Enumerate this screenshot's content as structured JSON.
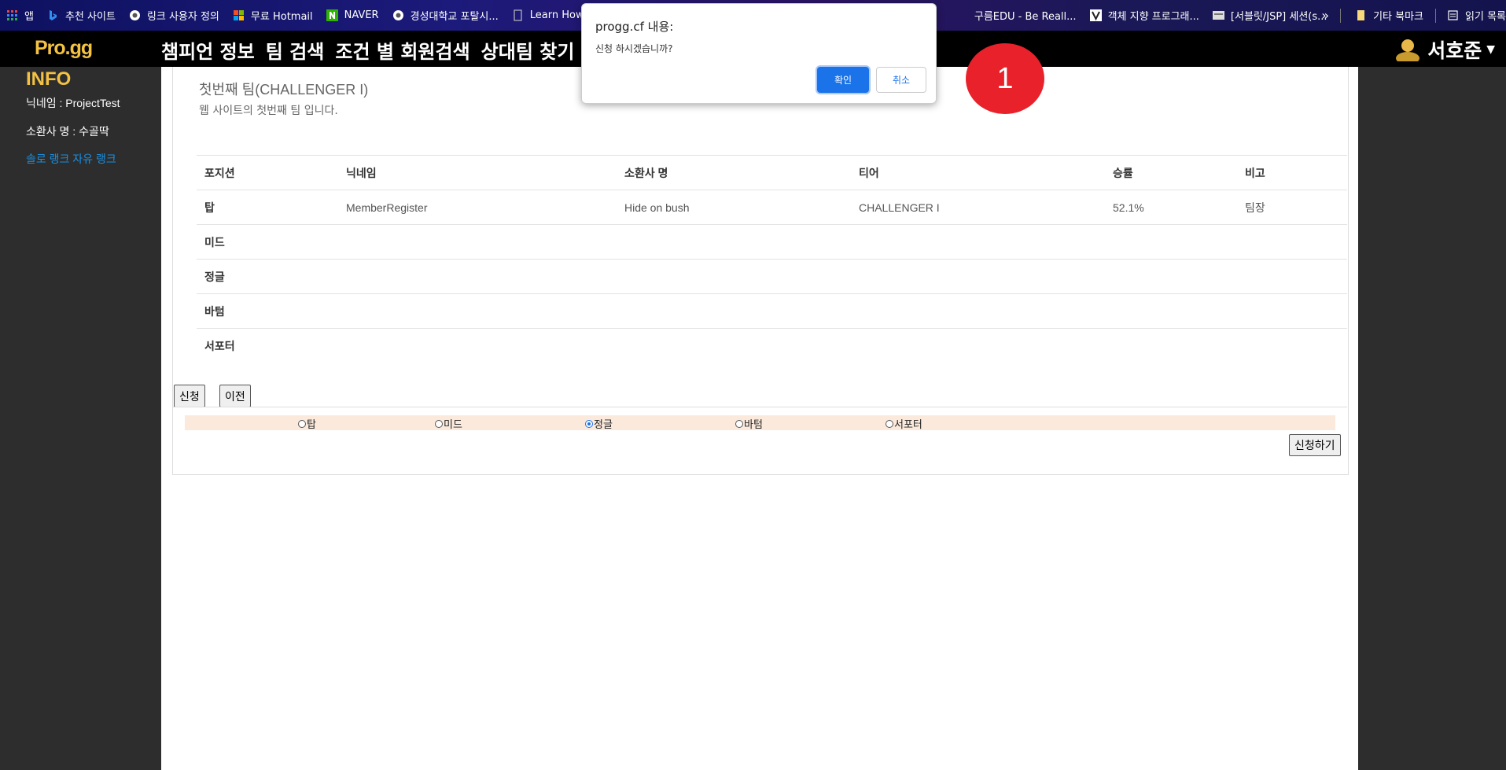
{
  "bookmarks": [
    {
      "label": "앱",
      "icon": "apps-grid-icon"
    },
    {
      "label": "추천 사이트",
      "icon": "bing-icon"
    },
    {
      "label": "링크 사용자 정의",
      "icon": "globe-icon"
    },
    {
      "label": "무료 Hotmail",
      "icon": "microsoft-icon"
    },
    {
      "label": "NAVER",
      "icon": "naver-icon"
    },
    {
      "label": "경성대학교 포탈시...",
      "icon": "globe-icon"
    },
    {
      "label": "Learn How t",
      "icon": "page-icon"
    },
    {
      "label": "구름EDU - Be Reall...",
      "icon": "goorm-icon"
    },
    {
      "label": "객체 지향 프로그래...",
      "icon": "v-icon"
    },
    {
      "label": "[서블릿/JSP] 세션(s...",
      "icon": "blog-icon"
    }
  ],
  "bookmarks_right": {
    "overflow": "»",
    "other_bookmarks": "기타 북마크",
    "reading_list": "읽기 목록"
  },
  "nav": {
    "logo": "Pro.gg",
    "items": [
      "챔피언 정보",
      "팀 검색",
      "조건 별 회원검색",
      "상대팀 찾기"
    ],
    "user_name": "서호준"
  },
  "sidebar": {
    "title": "INFO",
    "nickname": "닉네임 : ProjectTest",
    "summoner": "소환사 명 : 수골딱",
    "rank_links": "솔로 랭크 자유 랭크"
  },
  "team": {
    "title": "첫번째 팀(CHALLENGER I)",
    "description": "웹 사이트의 첫번째 팀 입니다.",
    "columns": [
      "포지션",
      "닉네임",
      "소환사 명",
      "티어",
      "승률",
      "비고"
    ],
    "rows": [
      {
        "position": "탑",
        "nickname": "MemberRegister",
        "summoner": "Hide on bush",
        "tier": "CHALLENGER I",
        "winrate": "52.1%",
        "note": "팀장"
      },
      {
        "position": "미드",
        "nickname": "",
        "summoner": "",
        "tier": "",
        "winrate": "",
        "note": ""
      },
      {
        "position": "정글",
        "nickname": "",
        "summoner": "",
        "tier": "",
        "winrate": "",
        "note": ""
      },
      {
        "position": "바텀",
        "nickname": "",
        "summoner": "",
        "tier": "",
        "winrate": "",
        "note": ""
      },
      {
        "position": "서포터",
        "nickname": "",
        "summoner": "",
        "tier": "",
        "winrate": "",
        "note": ""
      }
    ]
  },
  "buttons": {
    "apply": "신청",
    "prev": "이전",
    "submit": "신청하기"
  },
  "position_options": {
    "options": [
      "탑",
      "미드",
      "정글",
      "바텀",
      "서포터"
    ],
    "selected": "정글"
  },
  "dialog": {
    "title": "progg.cf 내용:",
    "message": "신청 하시겠습니까?",
    "ok": "확인",
    "cancel": "취소"
  },
  "marker": "1",
  "colors": {
    "accent_gold": "#f3c243",
    "link_blue": "#1a35d0",
    "dialog_blue": "#1a73e8",
    "marker_red": "#e8212a"
  }
}
